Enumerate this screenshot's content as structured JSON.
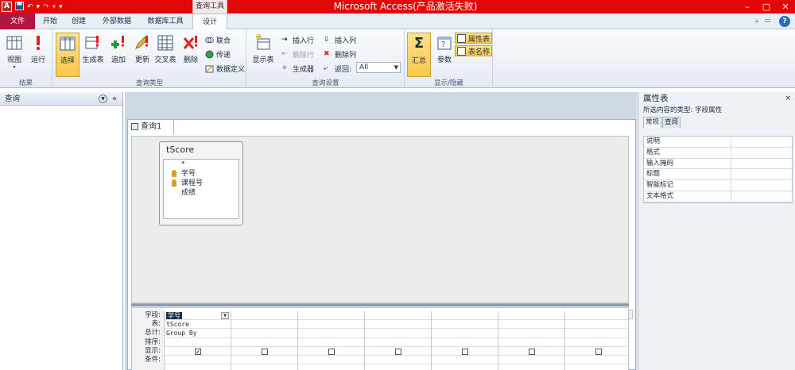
{
  "title_bar": {
    "app_icon": "A",
    "ctx_tab_label": "查询工具",
    "window_title": "Microsoft Access(产品激活失败)",
    "ctl_min": "–",
    "ctl_max": "▢",
    "ctl_close": "✕"
  },
  "tabs": {
    "file": "文件",
    "items": [
      "开始",
      "创建",
      "外部数据",
      "数据库工具",
      "设计"
    ],
    "help": "?"
  },
  "ribbon": {
    "groups": {
      "results": "结果",
      "query_type": "查询类型",
      "query_setup": "查询设置",
      "show_hide": "显示/隐藏"
    },
    "view": "视图",
    "run": "运行",
    "select": "选择",
    "make_table": "生成表",
    "append": "追加",
    "update": "更新",
    "crosstab": "交叉表",
    "delete": "删除",
    "union": "联合",
    "pass_through": "传递",
    "data_definition": "数据定义",
    "show_table": "显示表",
    "insert_rows": "插入行",
    "delete_rows": "删除行",
    "builder": "生成器",
    "insert_columns": "插入列",
    "delete_columns": "删除列",
    "return_label": "返回:",
    "return_value": "All",
    "totals": "汇总",
    "parameters": "参数",
    "property_sheet": "属性表",
    "table_names": "表名称"
  },
  "nav": {
    "title": "查询",
    "collapse": "«"
  },
  "query": {
    "tab_title": "查询1",
    "table_name": "tScore",
    "fields": [
      "*",
      "学号",
      "课程号",
      "成绩"
    ]
  },
  "grid": {
    "row_labels": [
      "字段:",
      "表:",
      "总计:",
      "排序:",
      "显示:",
      "条件:"
    ],
    "field": "学号",
    "table": "tScore",
    "total": "Group By",
    "show_check": "✔"
  },
  "props": {
    "title": "属性表",
    "subtitle": "所选内容的类型: 字段属性",
    "tabs": [
      "常规",
      "查阅"
    ],
    "rows": [
      "说明",
      "格式",
      "输入掩码",
      "标题",
      "智能标记",
      "文本格式"
    ],
    "close": "×"
  },
  "colors": {
    "title_bar": "#e30808",
    "file_tab": "#b2163d",
    "active_button": "#f9c84b"
  }
}
